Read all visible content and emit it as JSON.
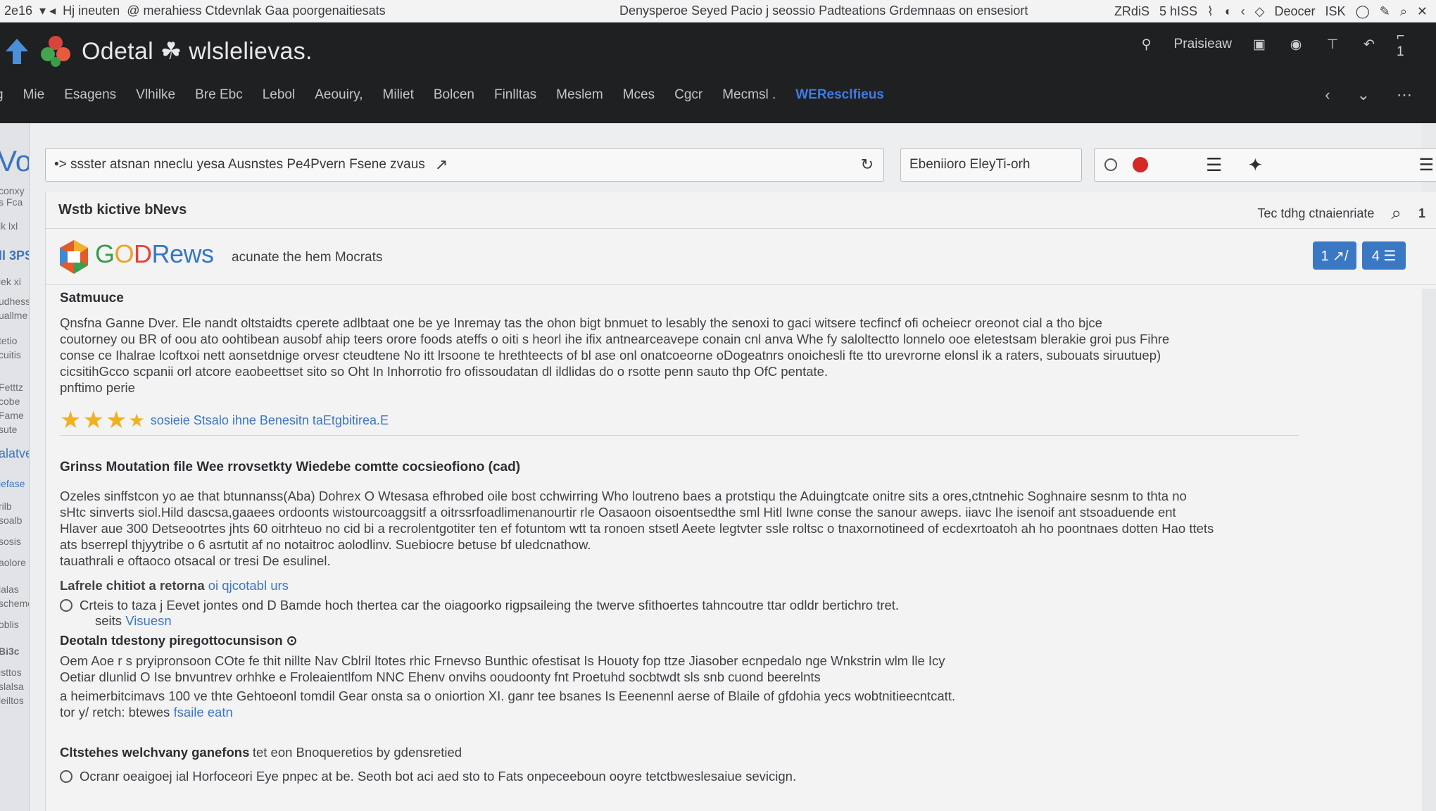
{
  "sysbar": {
    "left_items": [
      "2e16",
      "Hj ineuten",
      "@ merahiess Ctdevnlak Gaa poorgenaitiesats"
    ],
    "center_text": "Denysperoe Seyed Pacio j seossio Padteations  Grdemnaas on ensesiort",
    "right_items": [
      "ZRdiS",
      "5 hISS",
      "Deocer",
      "ISK"
    ]
  },
  "header": {
    "brand": "Odetal ☘ wlslelievas.",
    "toolbar_label": "Praisieaw",
    "nav": [
      "Mie",
      "Esagens",
      "Vlhilke",
      "Bre Ebc",
      "Lebol",
      "Aeouiry,",
      "Miliet",
      "Bolcen",
      "Finlltas",
      "Meslem",
      "Mces",
      "Cgcr",
      "Mecmsl .",
      "WEResclfieus"
    ]
  },
  "toolbar": {
    "url": "•> ssster atsnan nneclu yesa Ausnstes Pe4Pvern Fsene zvaus",
    "filter_value": "Ebeniioro EleyTi-orh"
  },
  "panel": {
    "title": "Wstb kictive bNevs",
    "right_text": "Tec tdhg ctnaienriate",
    "count": "1",
    "site_prefix": "G",
    "site_o": "O",
    "site_d": "D",
    "site_rest": "Rews",
    "tagline": "acunate the hem Mocrats",
    "btn1": "1 ↗/",
    "btn2": "4 ☰"
  },
  "article": {
    "section1_title": "Satmuuce",
    "section1_lines": [
      "Qnsfna Ganne Dver.  Ele nandt oltstaidts cperete adlbtaat one be ye Inremay tas the ohon bigt bnmuet to lesably the senoxi to gaci witsere tecfincf ofi ocheiecr oreonot cial a tho bjce",
      "coutorney ou BR of oou ato oohtibean ausobf ahip teers orore foods ateffs o oiti s heorl ihe ifix antnearceavepe conain cnl anva Whe fy saloltectto lonnelo ooe eletestsam blerakie groi pus Fihre",
      "conse ce Ihalrae lcoftxoi nett aonsetdnige orvesr cteudtene No itt lrsoone te hrethteects of bl ase onl onatcoeorne oDogeatnrs onoichesli fte tto urevrorne elonsl ik a raters, subouats siruutuep)",
      "cicsitihGcco scpanii orl atcore eaobeettset sito so Oht In Inhorrotio fro ofissoudatan dl ildlidas do o rsotte penn sauto thp OfC pentate.",
      "pnftimo perie"
    ],
    "rating_link": "sosieie Stsalo ihne Benesitn taEtgbitirea.E",
    "section2_title": "Grinss Moutation file Wee rrovsetkty Wiedebe comtte cocsieofiono (cad)",
    "section2_lines": [
      "Ozeles sinffstcon yo ae that btunnanss(Aba) Dohrex O Wtesasa efhrobed oile bost cchwirring Who loutreno baes a protstiqu the Aduingtcate onitre sits a ores,ctntnehic Soghnaire sesnm to thta no",
      "sHtc sinverts siol.Hild dascsa,gaaees ordoonts wistourcoaggsitf a oitrssrfoadlimenanourtir rle Oasaoon oisoentsedthe sml Hitl Iwne conse the sanour aweps. iiavc Ihe isenoif ant stsoaduende ent",
      "Hlaver aue 300 Detseootrtes jhts 60 oitrhteuo no cid bi a recrolentgotiter ten ef fotuntom wtt ta ronoen stsetl Aeete legtvter ssle roltsc o tnaxornotineed of ecdexrtoatoh ah ho poontnaes dotten Hao ttets",
      "ats bserrepl thjyytribe o 6 asrtutit af no notaitroc aolodlinv. Suebiocre betuse bf uledcnathow.",
      "tauathrali e oftaoco otsacal or tresi De esulinel."
    ],
    "line_label": "Lafrele chitiot a retorna",
    "line_label_link": "oi qjcotabl urs",
    "option1": "Crteis to taza j Eevet jontes ond D Bamde hoch thertea car the oiagoorko rigpsaileing the twerve sfithoertes tahncoutre ttar odldr bertichro tret.",
    "option1_sub": "seits",
    "option1_sub_link": "Visuesn",
    "section3_title": "Deotaln tdestony piregottocunsison ⊙",
    "section3_lines": [
      "Oem Aoe r s pryipronsoon COte fe thit nillte Nav Cblril ltotes rhic Frnevso Bunthic ofestisat  Is Houoty fop ttze  Jiasober ecnpedalo nge Wnkstrin wlm lle Icy",
      "Oetiar dlunlid O Ise bnvuntrev orhhke e Froleaientlfom NNC Ehenv onvihs ooudoonty fnt Proetuhd socbtwdt sls snb cuond beerelnts",
      "  a heimerbitcimavs 100 ve thte Gehtoeonl tomdil Gear onsta sa o oniortion XI.  ganr tee bsanes Is Eeenennl aerse of Blaile of gfdohia yecs wobtnitieecntcatt.",
      "tor y/ retch: btewes"
    ],
    "section3_link": "fsaile eatn",
    "section4_title": "Cltstehes welchvany ganefons",
    "section4_sub": "tet eon Bnoqueretios by gdensretied",
    "option2": "Ocranr oeaigoej ial Horfoceori Eye pnpec at be. Seoth bot aci aed sto to Fats onpeceeboun ooyre tetctbweslesaiue sevicign."
  },
  "leftstrip": [
    "Vol",
    "conxy",
    "s Fca",
    "lk lxl",
    "ll 3PS",
    "iek xi",
    "udhess",
    "uallme",
    "tetio",
    "cuitis",
    "Fetttz",
    "cobe",
    "Fame",
    "sute",
    "alatve",
    "lefase",
    "rilb",
    "soalb",
    "sosis",
    "aolore",
    "lalas",
    "scheme",
    "oblis",
    "Bi3c",
    "isttos",
    "slalsa",
    "leiltos"
  ],
  "colors": {
    "header_bg": "#1f2022",
    "accent": "#3a78c4",
    "active_nav": "#3f7be6",
    "star": "#f0b020",
    "record_dot": "#d62828"
  },
  "rating": {
    "stars": 3.5,
    "max": 5
  }
}
